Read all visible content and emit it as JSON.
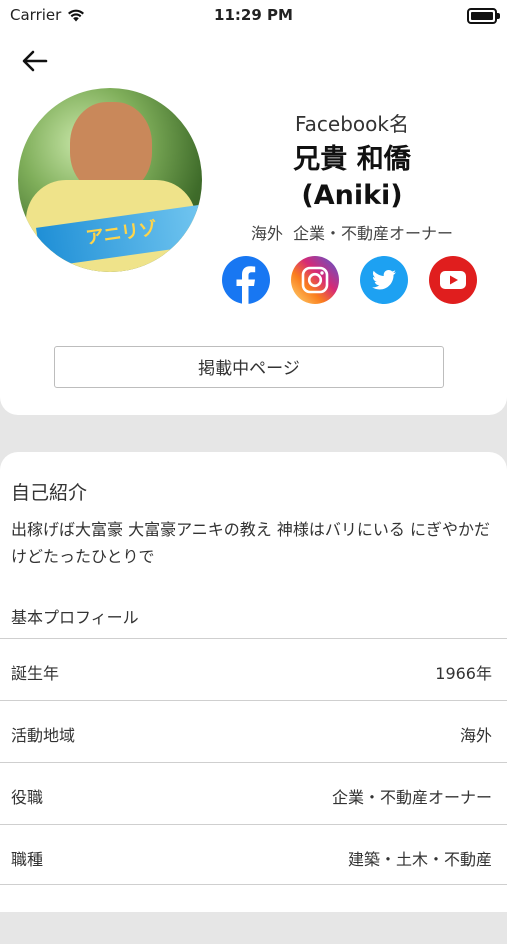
{
  "status_bar": {
    "carrier": "Carrier",
    "time": "11:29 PM"
  },
  "profile": {
    "facebook_label": "Facebook名",
    "name_line1": "兄貴 和僑",
    "name_line2": "(Aniki)",
    "region": "海外",
    "role": "企業・不動産オーナー",
    "avatar_banner_text": "アニリゾ",
    "listing_button": "掲載中ページ"
  },
  "social": [
    {
      "name": "facebook-icon",
      "color": "#1877f2"
    },
    {
      "name": "instagram-icon",
      "color": "#d62976"
    },
    {
      "name": "twitter-icon",
      "color": "#1da1f2"
    },
    {
      "name": "youtube-icon",
      "color": "#e01e1e"
    }
  ],
  "intro": {
    "title": "自己紹介",
    "body": "出稼げば大富豪 大富豪アニキの教え 神様はバリにいる にぎやかだけどたったひとりで"
  },
  "basic_profile": {
    "heading": "基本プロフィール",
    "rows": [
      {
        "label": "誕生年",
        "value": "1966年"
      },
      {
        "label": "活動地域",
        "value": "海外"
      },
      {
        "label": "役職",
        "value": "企業・不動産オーナー"
      },
      {
        "label": "職種",
        "value": "建築・土木・不動産"
      }
    ]
  }
}
